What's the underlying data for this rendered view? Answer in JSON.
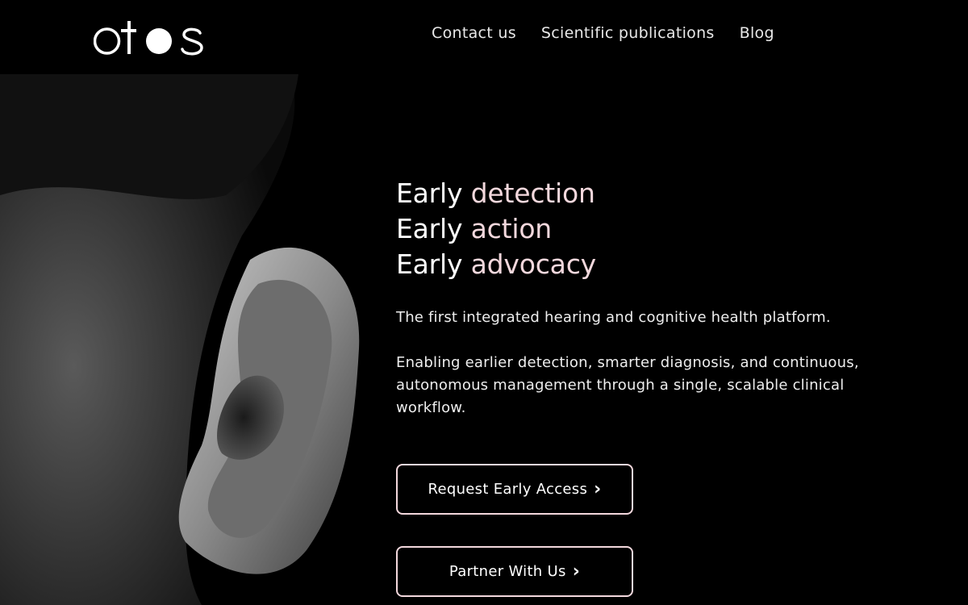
{
  "brand": {
    "name": "otos"
  },
  "nav": {
    "links": [
      "Contact us",
      "Scientific publications",
      "Blog"
    ]
  },
  "hero": {
    "lines": [
      {
        "lead": "Early",
        "accent": "detection"
      },
      {
        "lead": "Early",
        "accent": "action"
      },
      {
        "lead": "Early",
        "accent": "advocacy"
      }
    ],
    "paragraphs": [
      "The first integrated hearing and cognitive health platform.",
      "Enabling earlier detection, smarter diagnosis, and continuous, autonomous management through a single, scalable clinical workflow."
    ]
  },
  "cta": {
    "primary": "Request Early Access",
    "secondary": "Partner With Us"
  },
  "colors": {
    "background": "#000000",
    "accent": "#f3d8dd",
    "text": "#ffffff"
  },
  "icons": [
    "chevron-right-icon"
  ]
}
